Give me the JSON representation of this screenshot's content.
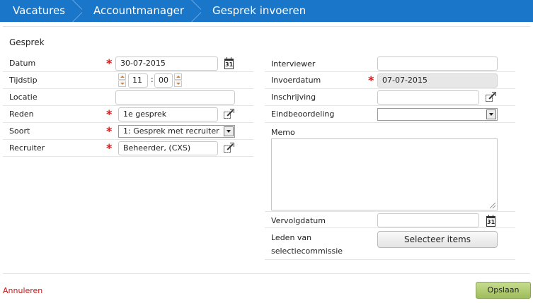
{
  "breadcrumb": [
    "Vacatures",
    "Accountmanager",
    "Gesprek invoeren"
  ],
  "section_title": "Gesprek",
  "left": {
    "datum": {
      "label": "Datum",
      "value": "30-07-2015",
      "required_mark": "*"
    },
    "tijdstip": {
      "label": "Tijdstip",
      "hour": "11",
      "sep": ":",
      "minute": "00"
    },
    "locatie": {
      "label": "Locatie",
      "value": ""
    },
    "reden": {
      "label": "Reden",
      "value": "1e gesprek",
      "required_mark": "*"
    },
    "soort": {
      "label": "Soort",
      "value": "1: Gesprek met recruiter",
      "required_mark": "*"
    },
    "recruiter": {
      "label": "Recruiter",
      "value": "Beheerder, (CXS)",
      "required_mark": "*"
    }
  },
  "right": {
    "interviewer": {
      "label": "Interviewer",
      "value": ""
    },
    "invoerdatum": {
      "label": "Invoerdatum",
      "value": "07-07-2015",
      "required_mark": "*"
    },
    "inschrijving": {
      "label": "Inschrijving",
      "value": ""
    },
    "eindbeoordeling": {
      "label": "Eindbeoordeling",
      "value": ""
    },
    "memo": {
      "label": "Memo",
      "value": ""
    },
    "vervolgdatum": {
      "label": "Vervolgdatum",
      "value": ""
    },
    "leden": {
      "label_line1": "Leden van",
      "label_line2": "selectiecommissie",
      "button": "Selecteer items"
    }
  },
  "calendar_icon_text": "31",
  "footer": {
    "cancel": "Annuleren",
    "save": "Opslaan"
  },
  "colors": {
    "header": "#1a76c9",
    "required": "#cc2222",
    "cancel": "#c01818",
    "save": "#a8c466"
  }
}
